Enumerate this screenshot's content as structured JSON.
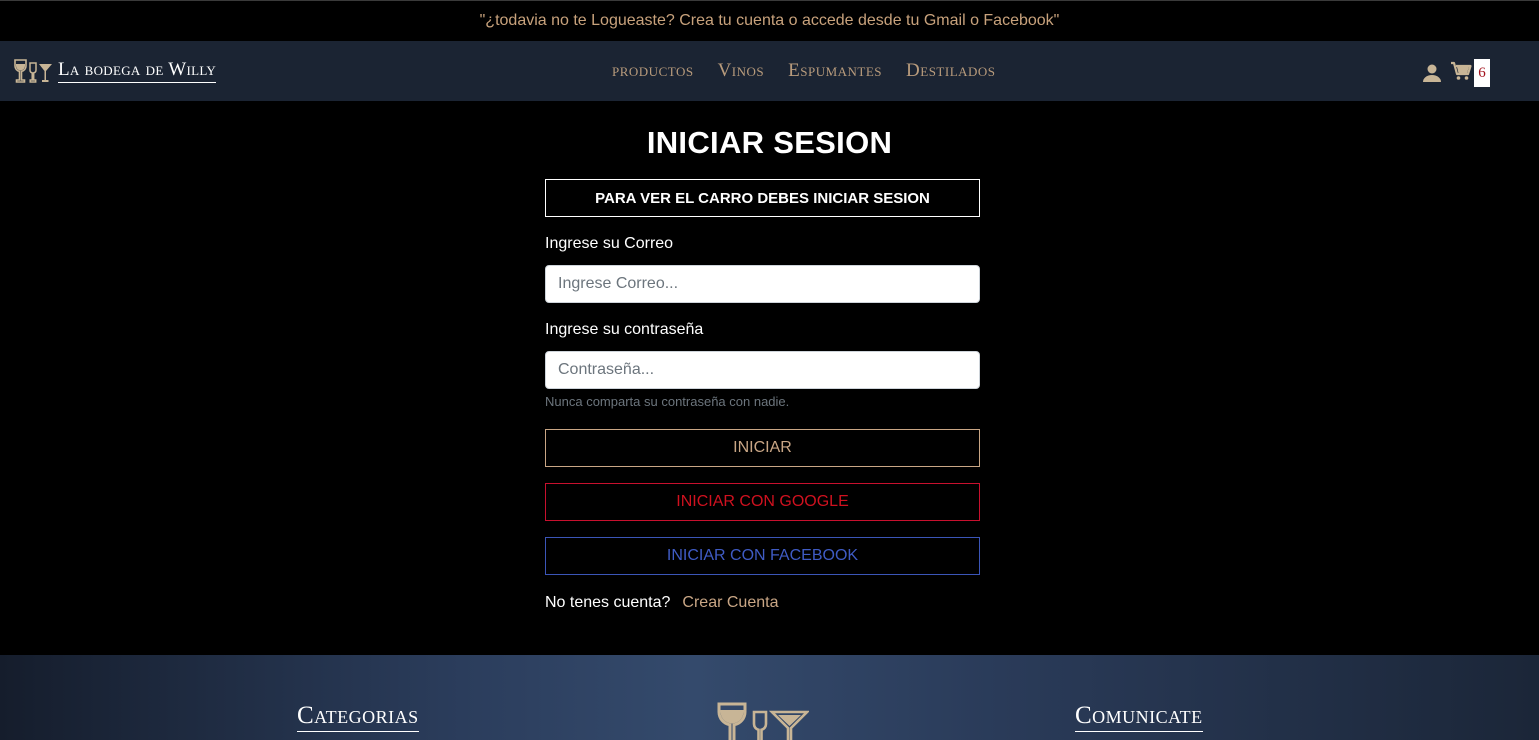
{
  "announcement": "\"¿todavia no te Logueaste? Crea tu cuenta o accede desde tu Gmail o Facebook\"",
  "navbar": {
    "brand": "La bodega de Willy",
    "links": [
      "productos",
      "Vinos",
      "Espumantes",
      "Destilados"
    ],
    "cart_count": "6",
    "icons": {
      "user": "user-icon",
      "cart": "cart-icon",
      "brand": "wine-glasses-icon"
    }
  },
  "login": {
    "title": "INICIAR SESION",
    "alert": "PARA VER EL CARRO DEBES INICIAR SESION",
    "email_label": "Ingrese su Correo",
    "email_placeholder": "Ingrese Correo...",
    "password_label": "Ingrese su contraseña",
    "password_placeholder": "Contraseña...",
    "password_help": "Nunca comparta su contraseña con nadie.",
    "login_button": "INICIAR",
    "google_button": "INICIAR CON GOOGLE",
    "facebook_button": "INICIAR CON FACEBOOK",
    "signup_question": "No tenes cuenta?",
    "signup_link": "Crear Cuenta"
  },
  "footer": {
    "categories_heading": "Categorias",
    "contact_heading": "Comunicate"
  },
  "colors": {
    "accent": "#c9a685",
    "navbar_bg": "#1b2433",
    "google": "#d0111f",
    "facebook": "#3f5bc4",
    "badge_text": "#a3121d"
  }
}
